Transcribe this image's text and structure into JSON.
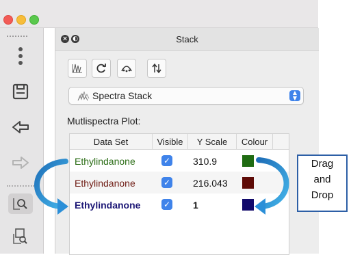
{
  "window": {
    "traffic_lights": [
      "close",
      "minimize",
      "zoom"
    ]
  },
  "left_toolbar": {
    "icons": [
      "grip-handle-icon",
      "more-vertical-icon",
      "save-icon",
      "undo-icon",
      "redo-icon",
      "zoom-box-icon",
      "zoom-select-icon"
    ]
  },
  "panel": {
    "title": "Stack",
    "header_icons": [
      "close-icon",
      "float-icon"
    ],
    "toolbar_icons": [
      "spectra-peaks-icon",
      "refresh-icon",
      "curve-fit-icon",
      "sort-icon"
    ],
    "stack_select": {
      "value": "Spectra Stack",
      "icon": "spectra-stack-icon"
    },
    "section_label": "Mutlispectra Plot:",
    "table": {
      "columns": [
        "Data Set",
        "Visible",
        "Y Scale",
        "Colour"
      ],
      "rows": [
        {
          "name": "Ethylindanone",
          "visible": "✓",
          "y_scale": "310.9",
          "color": "#1f6b12",
          "text_color": "#2b6d16",
          "bold": false
        },
        {
          "name": "Ethylindanone",
          "visible": "✓",
          "y_scale": "216.043",
          "color": "#5e0b07",
          "text_color": "#6e1a12",
          "bold": false
        },
        {
          "name": "Ethylindanone",
          "visible": "✓",
          "y_scale": "1",
          "color": "#120a6b",
          "text_color": "#1b1675",
          "bold": true
        }
      ]
    }
  },
  "annotation": {
    "lines": [
      "Drag",
      "and",
      "Drop"
    ],
    "arrow_color": "#2b8fd8"
  }
}
